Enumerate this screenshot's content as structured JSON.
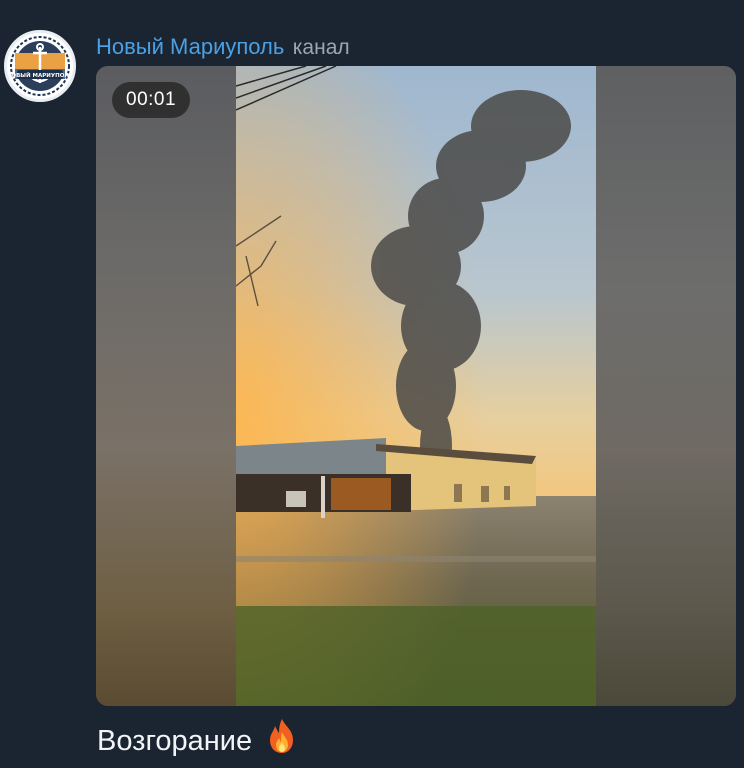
{
  "channel": {
    "name": "Новый Мариуполь",
    "type_label": "канал",
    "avatar_text": "НОВЫЙ МАРИУПОЛЬ"
  },
  "media": {
    "duration": "00:01"
  },
  "message": {
    "text": "Возгорание",
    "emoji_icon": "fire-icon"
  },
  "colors": {
    "background": "#1b2431",
    "channel_name": "#4ba0e4",
    "secondary_text": "#9aa7b5"
  }
}
